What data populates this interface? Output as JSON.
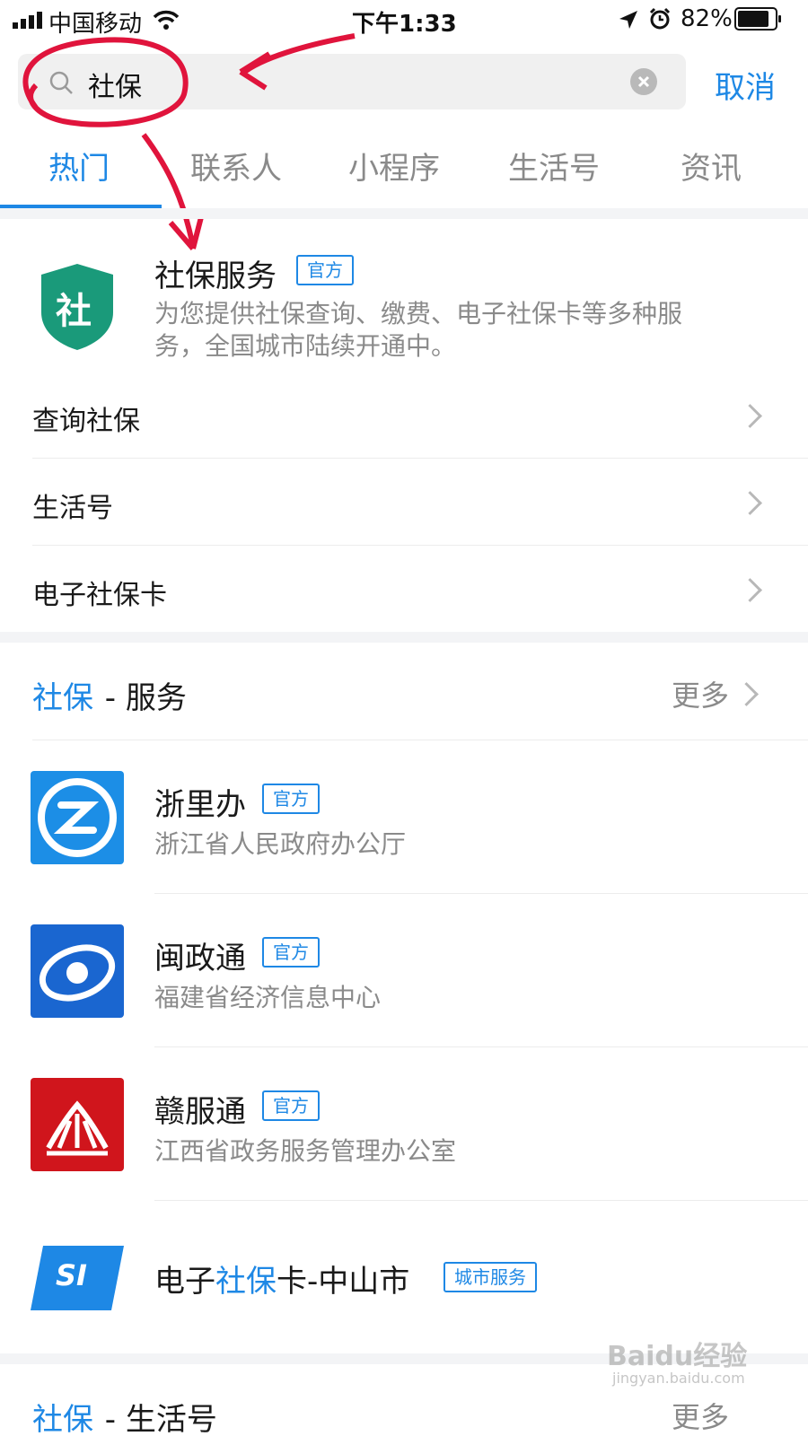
{
  "status_bar": {
    "carrier": "中国移动",
    "time": "下午1:33",
    "battery": "82%"
  },
  "search": {
    "query": "社保",
    "cancel_label": "取消"
  },
  "tabs": [
    {
      "label": "热门",
      "active": true
    },
    {
      "label": "联系人"
    },
    {
      "label": "小程序"
    },
    {
      "label": "生活号"
    },
    {
      "label": "资讯"
    }
  ],
  "top_result": {
    "icon_char": "社",
    "title": "社保服务",
    "badge": "官方",
    "description_line1": "为您提供社保查询、缴费、电子社保卡等多种服",
    "description_line2": "务，全国城市陆续开通中。",
    "links": [
      {
        "label": "查询社保"
      },
      {
        "label": "生活号"
      },
      {
        "label": "电子社保卡"
      }
    ]
  },
  "services_section": {
    "keyword": "社保",
    "suffix": " - 服务",
    "more_label": "更多",
    "items": [
      {
        "title": "浙里办",
        "badge": "官方",
        "subtitle": "浙江省人民政府办公厅"
      },
      {
        "title": "闽政通",
        "badge": "官方",
        "subtitle": "福建省经济信息中心"
      },
      {
        "title": "赣服通",
        "badge": "官方",
        "subtitle": "江西省政务服务管理办公室"
      },
      {
        "title_prefix": "电子",
        "title_highlight": "社保",
        "title_suffix": "卡-中山市",
        "badge": "城市服务",
        "icon_text": "SI"
      }
    ]
  },
  "next_section": {
    "keyword": "社保",
    "suffix": " - 生活号",
    "more_label": "更多"
  },
  "watermark": {
    "text": "Baidu经验",
    "url": "jingyan.baidu.com"
  },
  "colors": {
    "accent": "#1e88e5",
    "gray_text": "#8a8a8a",
    "shield_green": "#1a9a7a"
  }
}
